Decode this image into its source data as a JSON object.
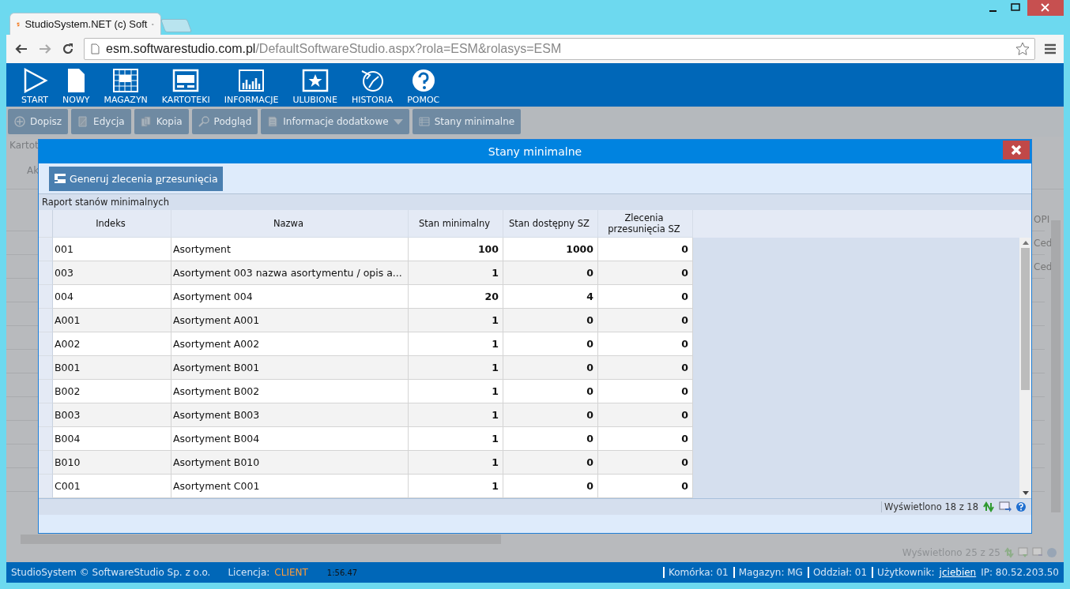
{
  "browser": {
    "tab_title": "StudioSystem.NET (c) Soft",
    "address_host": "esm.softwarestudio.com.pl",
    "address_path": "/DefaultSoftwareStudio.aspx?rola=ESM&rolasys=ESM"
  },
  "nav": [
    {
      "label": "START"
    },
    {
      "label": "NOWY"
    },
    {
      "label": "MAGAZYN"
    },
    {
      "label": "KARTOTEKI"
    },
    {
      "label": "INFORMACJE"
    },
    {
      "label": "ULUBIONE"
    },
    {
      "label": "HISTORIA"
    },
    {
      "label": "POMOC"
    }
  ],
  "toolbar": [
    {
      "label": "Dopisz",
      "has_menu": false
    },
    {
      "label": "Edycja",
      "has_menu": false
    },
    {
      "label": "Kopia",
      "has_menu": false
    },
    {
      "label": "Podgląd",
      "has_menu": false
    },
    {
      "label": "Informacje dodatkowe",
      "has_menu": true
    },
    {
      "label": "Stany minimalne",
      "has_menu": false
    }
  ],
  "background": {
    "breadcrumb": "Kartot",
    "column_label": "Ak",
    "right_cells": [
      "OPI",
      "Ced",
      "Ced"
    ],
    "footer": "Wyświetlono 25 z 25"
  },
  "dialog": {
    "title": "Stany minimalne",
    "action": {
      "label": "Generuj zlecenia przesunięcia"
    },
    "caption": "Raport stanów minimalnych",
    "columns": [
      {
        "label": "Indeks"
      },
      {
        "label": "Nazwa"
      },
      {
        "label": "Stan minimalny"
      },
      {
        "label": "Stan dostępny SZ"
      },
      {
        "label": "Zlecenia przesunięcia SZ"
      }
    ],
    "rows": [
      [
        "001",
        "Asortyment",
        "100",
        "1000",
        "0"
      ],
      [
        "003",
        "Asortyment 003 nazwa asortymentu / opis a...",
        "1",
        "0",
        "0"
      ],
      [
        "004",
        "Asortyment 004",
        "20",
        "4",
        "0"
      ],
      [
        "A001",
        "Asortyment A001",
        "1",
        "0",
        "0"
      ],
      [
        "A002",
        "Asortyment A002",
        "1",
        "0",
        "0"
      ],
      [
        "B001",
        "Asortyment B001",
        "1",
        "0",
        "0"
      ],
      [
        "B002",
        "Asortyment B002",
        "1",
        "0",
        "0"
      ],
      [
        "B003",
        "Asortyment B003",
        "1",
        "0",
        "0"
      ],
      [
        "B004",
        "Asortyment B004",
        "1",
        "0",
        "0"
      ],
      [
        "B010",
        "Asortyment B010",
        "1",
        "0",
        "0"
      ],
      [
        "C001",
        "Asortyment C001",
        "1",
        "0",
        "0"
      ]
    ],
    "footer": "Wyświetlono 18 z 18"
  },
  "status_bar": {
    "copyright": "StudioSystem © SoftwareStudio Sp. z o.o.",
    "license_label": "Licencja:",
    "license_value": "CLIENT",
    "time": "1:56.47",
    "fields": [
      {
        "label": "Komórka:",
        "value": "01"
      },
      {
        "label": "Magazyn:",
        "value": "MG"
      },
      {
        "label": "Oddział:",
        "value": "01"
      }
    ],
    "user_label": "Użytkownik:",
    "user": "jciebien",
    "ip": "IP: 80.52.203.50"
  }
}
